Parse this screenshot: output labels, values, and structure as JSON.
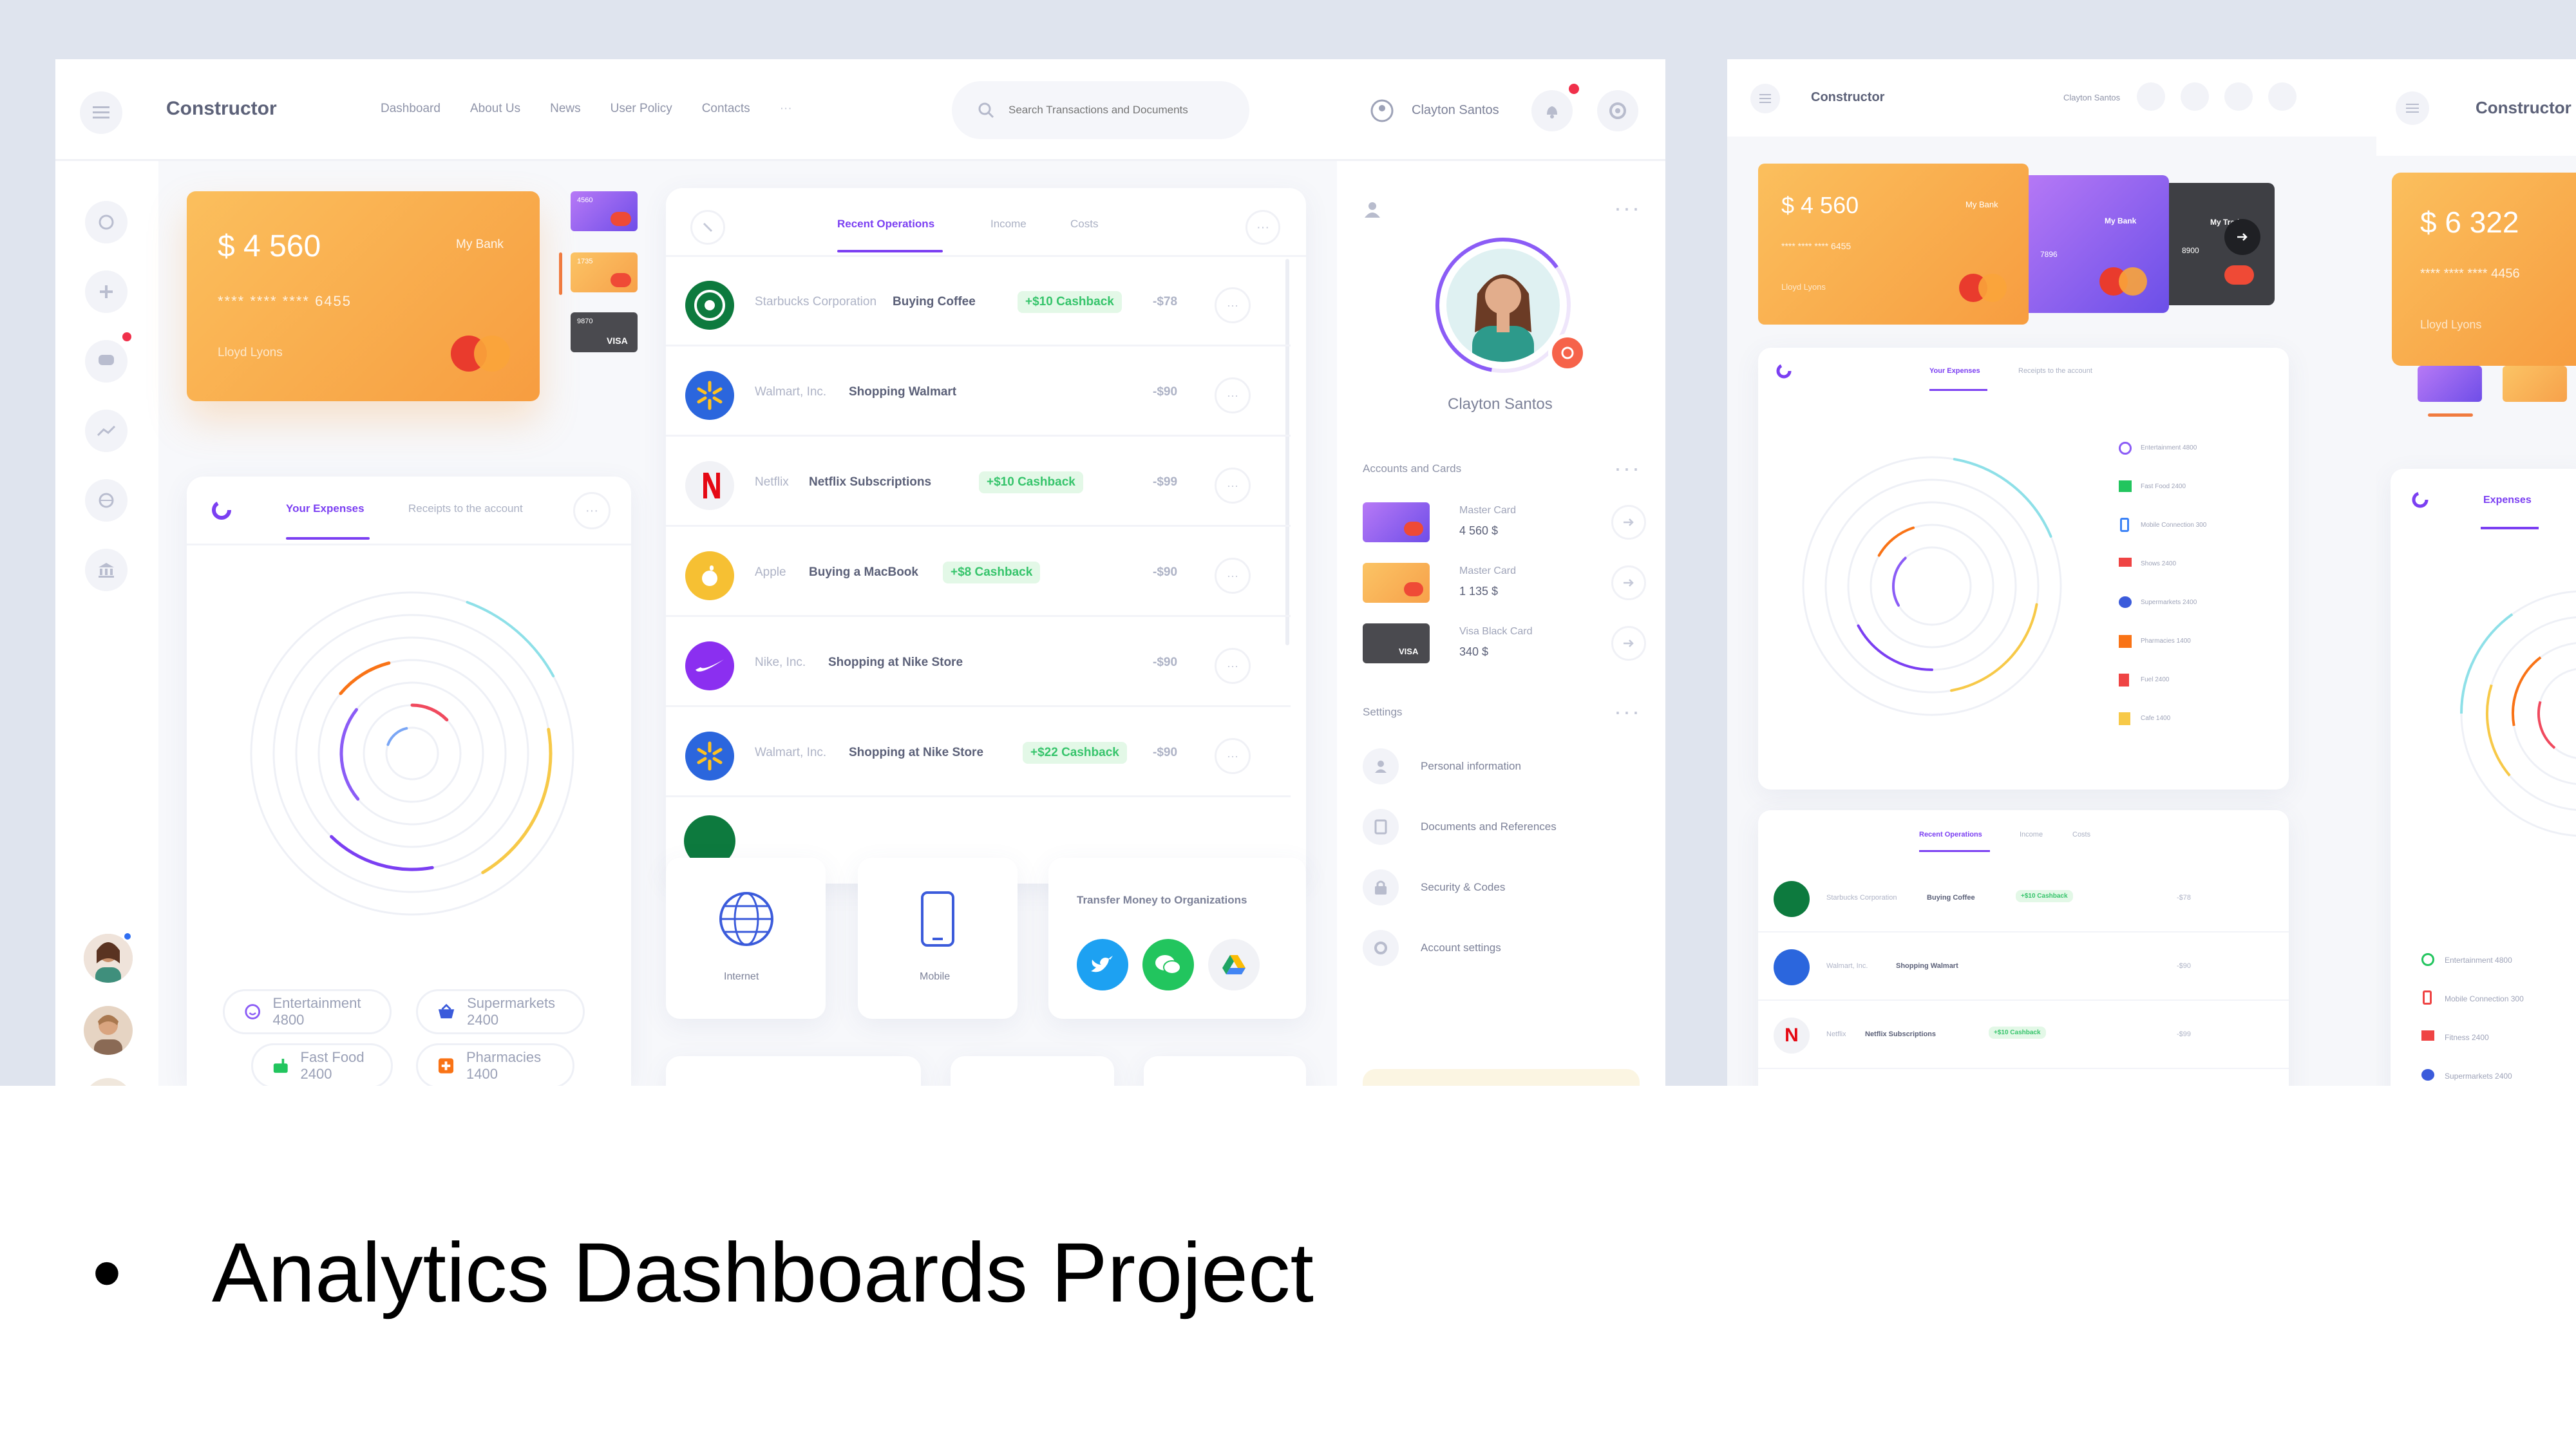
{
  "app": {
    "brand": "Constructor"
  },
  "nav": {
    "items": [
      "Dashboard",
      "About Us",
      "News",
      "User Policy",
      "Contacts"
    ],
    "more": "···"
  },
  "search": {
    "placeholder": "Search Transactions and Documents"
  },
  "user": {
    "name": "Clayton Santos"
  },
  "cards": [
    {
      "amount": "$ 4 560",
      "bank": "My Bank",
      "number": "**** **** **** 6455",
      "holder": "Lloyd Lyons"
    },
    {
      "amount": "$ 6 322",
      "number": "**** **** **** 4456",
      "holder": "Lloyd Lyons"
    }
  ],
  "mini_cards": [
    {
      "label": "4560"
    },
    {
      "label": "1735"
    },
    {
      "label": "9870",
      "brand": "VISA"
    }
  ],
  "overlay_cards": [
    {
      "bank": "My Bank",
      "digits": "7896"
    },
    {
      "bank": "My Trade",
      "digits": "8900"
    }
  ],
  "expenses": {
    "tabs": [
      "Your Expenses",
      "Receipts to the account"
    ],
    "legend": [
      {
        "label": "Entertainment 4800",
        "icon": "smile-icon",
        "color": "#8b5cf6"
      },
      {
        "label": "Supermarkets 2400",
        "icon": "basket-icon",
        "color": "#3b5bdb"
      },
      {
        "label": "Fast Food 2400",
        "icon": "burger-icon",
        "color": "#22c55e"
      },
      {
        "label": "Pharmacies 1400",
        "icon": "cross-icon",
        "color": "#f97316"
      }
    ]
  },
  "operations": {
    "tabs": [
      "Recent Operations",
      "Income",
      "Costs"
    ],
    "rows": [
      {
        "company": "Starbucks Corporation",
        "desc": "Buying Coffee",
        "cashback": "+$10 Cashback",
        "amount": "-$78",
        "logo_color": "#0d7a3e",
        "logo": "starbucks-logo-icon"
      },
      {
        "company": "Walmart, Inc.",
        "desc": "Shopping Walmart",
        "cashback": "",
        "amount": "-$90",
        "logo_color": "#2b66dd",
        "logo": "walmart-logo-icon"
      },
      {
        "company": "Netflix",
        "desc": "Netflix Subscriptions",
        "cashback": "+$10 Cashback",
        "amount": "-$99",
        "logo_color": "#f1f2f6",
        "logo": "netflix-logo-icon"
      },
      {
        "company": "Apple",
        "desc": "Buying a MacBook",
        "cashback": "+$8 Cashback",
        "amount": "-$90",
        "logo_color": "#f6c033",
        "logo": "apple-logo-icon"
      },
      {
        "company": "Nike, Inc.",
        "desc": "Shopping at Nike Store",
        "cashback": "",
        "amount": "-$90",
        "logo_color": "#8b2ff0",
        "logo": "nike-logo-icon"
      },
      {
        "company": "Walmart, Inc.",
        "desc": "Shopping at Nike Store",
        "cashback": "+$22 Cashback",
        "amount": "-$90",
        "logo_color": "#2b66dd",
        "logo": "walmart-logo-icon"
      }
    ]
  },
  "services": [
    {
      "label": "Internet",
      "icon": "globe-icon"
    },
    {
      "label": "Mobile",
      "icon": "phone-icon"
    }
  ],
  "transfer": {
    "title": "Transfer Money to Organizations"
  },
  "profile": {
    "name": "Clayton Santos",
    "accounts_title": "Accounts and Cards",
    "accounts": [
      {
        "name": "Master Card",
        "value": "4 560 $"
      },
      {
        "name": "Master Card",
        "value": "1 135 $"
      },
      {
        "name": "Visa Black Card",
        "value": "340 $"
      }
    ],
    "settings_title": "Settings",
    "settings": [
      "Personal information",
      "Documents and References",
      "Security & Codes",
      "Account settings"
    ]
  },
  "right_legend": [
    "Entertainment 4800",
    "Fast Food 2400",
    "Mobile Connection 300",
    "Shows 2400",
    "Supermarkets 2400",
    "Pharmacies 1400",
    "Fuel 2400",
    "Cafe 1400"
  ],
  "third_panel": {
    "tab": "Expenses",
    "legend": [
      "Entertainment 4800",
      "Mobile Connection 300",
      "Fitness 2400",
      "Supermarkets 2400"
    ]
  },
  "slide": {
    "bullet": "•",
    "caption": "Analytics Dashboards Project"
  },
  "colors": {
    "accent": "#7b3ff2",
    "orange": "#f7a641",
    "green": "#36c46b"
  }
}
